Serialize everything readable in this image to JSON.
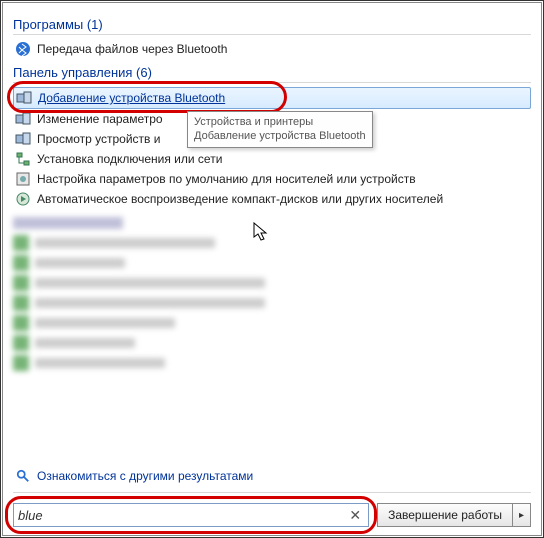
{
  "sections": {
    "programs": {
      "header": "Программы (1)",
      "items": [
        {
          "icon": "bluetooth-icon",
          "label": "Передача файлов через Bluetooth"
        }
      ]
    },
    "control_panel": {
      "header": "Панель управления (6)",
      "items": [
        {
          "icon": "devices-icon",
          "label": "Добавление устройства Bluetooth",
          "selected": true
        },
        {
          "icon": "devices-icon",
          "label": "Изменение параметро"
        },
        {
          "icon": "devices-icon",
          "label": "Просмотр устройств и"
        },
        {
          "icon": "network-icon",
          "label": "Установка подключения или сети"
        },
        {
          "icon": "settings-icon",
          "label": "Настройка параметров по умолчанию для носителей или устройств"
        },
        {
          "icon": "autoplay-icon",
          "label": "Автоматическое воспроизведение компакт-дисков или других носителей"
        }
      ]
    }
  },
  "tooltip": {
    "line1": "Устройства и принтеры",
    "line2": "Добавление устройства Bluetooth"
  },
  "see_more": "Ознакомиться с другими результатами",
  "search": {
    "value": "blue",
    "placeholder": ""
  },
  "shutdown": {
    "label": "Завершение работы"
  }
}
